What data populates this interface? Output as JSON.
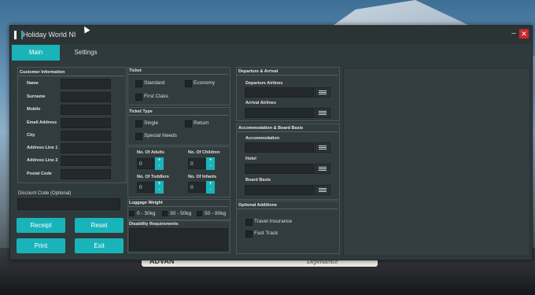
{
  "window": {
    "title": "Holiday World NI",
    "minimize_label": "–",
    "close_label": "✕"
  },
  "tabs": [
    {
      "label": "Main"
    },
    {
      "label": "Settings"
    }
  ],
  "customer": {
    "title": "Customer Information",
    "fields": [
      {
        "label": "Name"
      },
      {
        "label": "Surname"
      },
      {
        "label": "Mobile"
      },
      {
        "label": "Email Address"
      },
      {
        "label": "City"
      },
      {
        "label": "Address Line 1"
      },
      {
        "label": "Address Line 2"
      },
      {
        "label": "Postal Code"
      }
    ]
  },
  "discount": {
    "label": "Discount Code (Optional)"
  },
  "buttons": {
    "receipt": "Receipt",
    "reset": "Reset",
    "print": "Print",
    "exit": "Exit"
  },
  "ticket": {
    "title": "Ticket",
    "options": [
      "Standard",
      "Economy",
      "First Class"
    ]
  },
  "ticket_type": {
    "title": "Ticket Type",
    "options": [
      "Single",
      "Return",
      "Special Needs"
    ]
  },
  "counts": {
    "adults": {
      "label": "No. Of Adults",
      "value": "0"
    },
    "children": {
      "label": "No. Of Children",
      "value": "0"
    },
    "toddlers": {
      "label": "No. Of Toddlers",
      "value": "0"
    },
    "infants": {
      "label": "No. Of Infants",
      "value": "0"
    },
    "up": "+",
    "down": "-"
  },
  "luggage": {
    "title": "Luggage Weight",
    "options": [
      "0 - 30kg",
      "30 - 50kg",
      "50 - 80kg"
    ]
  },
  "disability": {
    "title": "Disability Requirements"
  },
  "departure": {
    "title": "Departure & Arrival",
    "departure_label": "Departure Airlines",
    "arrival_label": "Arrival Airlines"
  },
  "accommodation": {
    "title": "Accommodation & Board Basis",
    "accommodation_label": "Accommodation",
    "hotel_label": "Hotel",
    "board_label": "Board Basis"
  },
  "optional": {
    "title": "Optional Additions",
    "options": [
      "Travel Insurance",
      "Fast Track"
    ]
  },
  "background": {
    "car_left": "ADVAN",
    "car_right": "Dependence"
  },
  "colors": {
    "accent": "#19b4b9",
    "window": "#2f3a3d",
    "close": "#c8282e"
  }
}
